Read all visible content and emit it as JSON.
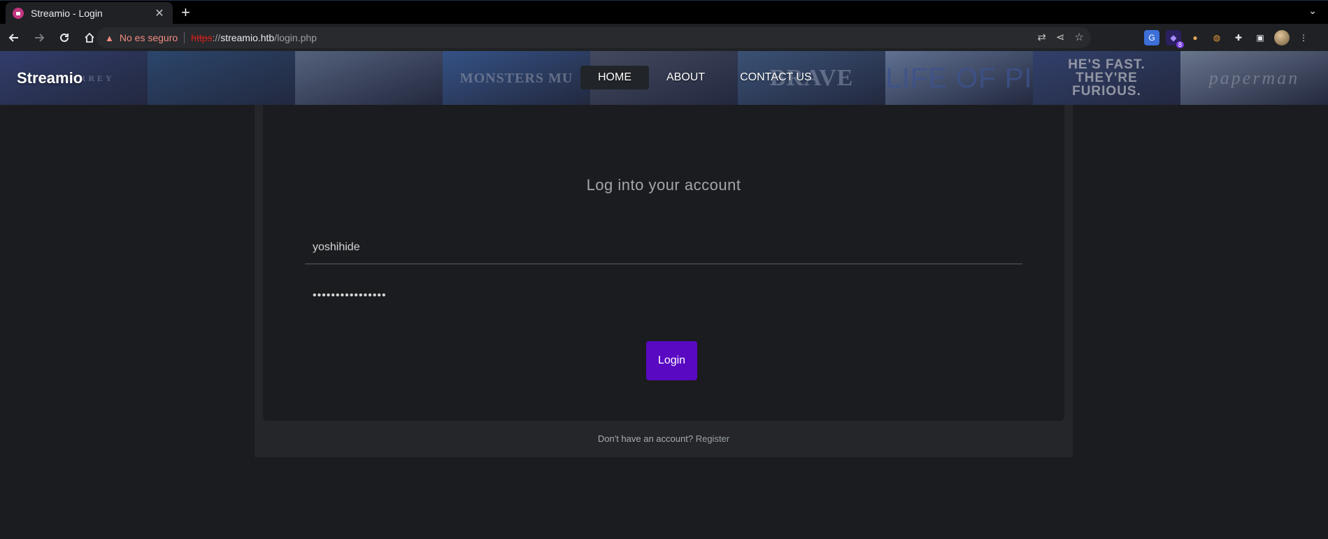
{
  "browser": {
    "tab_title": "Streamio - Login",
    "tab_close": "✕",
    "new_tab": "+",
    "tab_menu": "⌄",
    "security_text": "No es seguro",
    "url_scheme": "https",
    "url_sep": "://",
    "url_host": "streamio.htb",
    "url_path": "/login.php",
    "extension_badge": "8"
  },
  "site": {
    "brand": "Streamio",
    "nav": [
      {
        "label": "HOME",
        "active": true
      },
      {
        "label": "ABOUT",
        "active": false
      },
      {
        "label": "CONTACT US",
        "active": false
      }
    ],
    "posters": [
      {
        "text": "JIM CARREY",
        "color": "#3b4a8a"
      },
      {
        "text": "",
        "color": "#2e5a8a"
      },
      {
        "text": "",
        "color": "#7a8ca8"
      },
      {
        "text": "MONSTERS MU",
        "color": "#3f6fb8"
      },
      {
        "text": "",
        "color": "#5a5f74"
      },
      {
        "text": "BRAVE",
        "color": "#4a6f9c"
      },
      {
        "text": "LIFE OF PI",
        "color": "#8fa8d0"
      },
      {
        "text": "HE'S FAST. THEY'RE FURIOUS.",
        "color": "#3b4f8a"
      },
      {
        "text": "paperman",
        "color": "#9fb0c8"
      }
    ]
  },
  "login": {
    "title": "Log into your account",
    "username_value": "yoshihide",
    "password_value": "••••••••••••••••",
    "button_label": "Login",
    "register_prompt": "Don't have an account?",
    "register_link": "Register"
  }
}
